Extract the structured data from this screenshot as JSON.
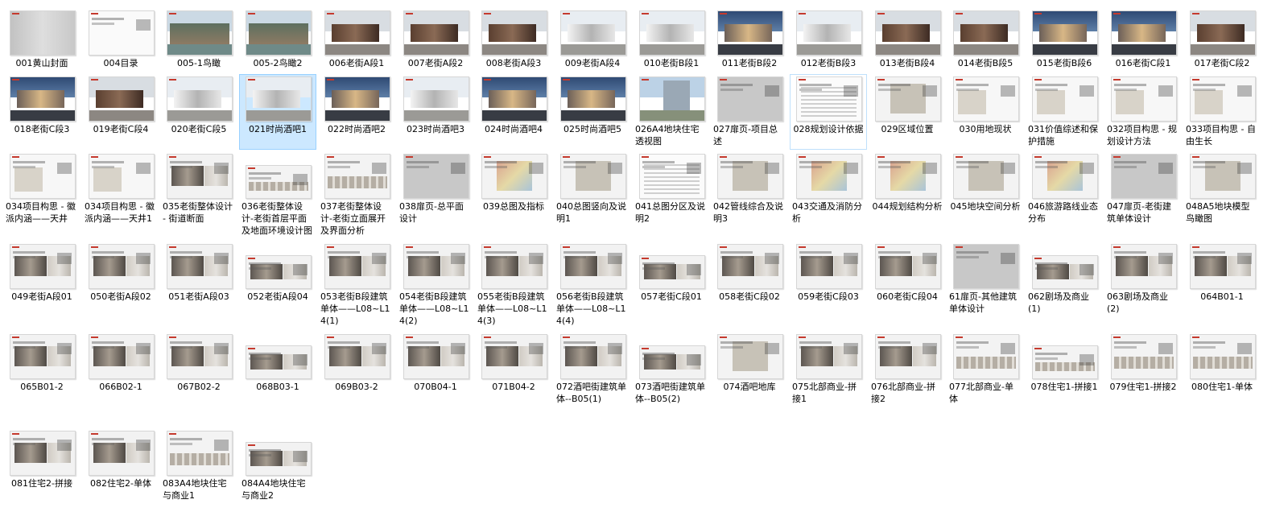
{
  "files": [
    {
      "name": "001黄山封面",
      "thumb": "cover"
    },
    {
      "name": "004目录",
      "thumb": "white"
    },
    {
      "name": "005-1鸟瞰",
      "thumb": "aerial"
    },
    {
      "name": "005-2鸟瞰2",
      "thumb": "aerial"
    },
    {
      "name": "006老街A段1",
      "thumb": "street"
    },
    {
      "name": "007老街A段2",
      "thumb": "street"
    },
    {
      "name": "008老街A段3",
      "thumb": "street"
    },
    {
      "name": "009老街A段4",
      "thumb": "modern"
    },
    {
      "name": "010老街B段1",
      "thumb": "modern"
    },
    {
      "name": "011老街B段2",
      "thumb": "dusk"
    },
    {
      "name": "012老街B段3",
      "thumb": "modern"
    },
    {
      "name": "013老街B段4",
      "thumb": "street"
    },
    {
      "name": "014老街B段5",
      "thumb": "street"
    },
    {
      "name": "015老街B段6",
      "thumb": "dusk"
    },
    {
      "name": "016老街C段1",
      "thumb": "dusk"
    },
    {
      "name": "017老街C段2",
      "thumb": "street"
    },
    {
      "name": "018老街C段3",
      "thumb": "dusk"
    },
    {
      "name": "019老街C段4",
      "thumb": "street"
    },
    {
      "name": "020老街C段5",
      "thumb": "modern"
    },
    {
      "name": "021时尚酒吧1",
      "thumb": "modern"
    },
    {
      "name": "022时尚酒吧2",
      "thumb": "dusk"
    },
    {
      "name": "023时尚酒吧3",
      "thumb": "modern"
    },
    {
      "name": "024时尚酒吧4",
      "thumb": "dusk"
    },
    {
      "name": "025时尚酒吧5",
      "thumb": "dusk"
    },
    {
      "name": "026A4地块住宅透视图",
      "thumb": "tower"
    },
    {
      "name": "027扉页-项目总述",
      "thumb": "grey"
    },
    {
      "name": "028规划设计依据",
      "thumb": "textdoc"
    },
    {
      "name": "029区域位置",
      "thumb": "plan"
    },
    {
      "name": "030用地现状",
      "thumb": "doc"
    },
    {
      "name": "031价值综述和保护措施",
      "thumb": "doc"
    },
    {
      "name": "032项目构思 - 规划设计方法",
      "thumb": "doc"
    },
    {
      "name": "033项目构思 - 自由生长",
      "thumb": "doc"
    },
    {
      "name": "034项目构思 - 徽派内涵——天井",
      "thumb": "doc"
    },
    {
      "name": "034项目构思 - 徽派内涵——天井1",
      "thumb": "doc"
    },
    {
      "name": "035老街整体设计 - 街道断面",
      "thumb": "board"
    },
    {
      "name": "036老街整体设计-老街首层平面及地面环境设计图",
      "thumb": "elev"
    },
    {
      "name": "037老街整体设计-老街立面展开及界面分析",
      "thumb": "elev"
    },
    {
      "name": "038扉页-总平面设计",
      "thumb": "grey"
    },
    {
      "name": "039总图及指标",
      "thumb": "plan color"
    },
    {
      "name": "040总图竖向及说明1",
      "thumb": "plan"
    },
    {
      "name": "041总图分区及说明2",
      "thumb": "textdoc"
    },
    {
      "name": "042管线综合及说明3",
      "thumb": "plan"
    },
    {
      "name": "043交通及消防分析",
      "thumb": "plan color"
    },
    {
      "name": "044规划结构分析",
      "thumb": "plan color"
    },
    {
      "name": "045地块空间分析",
      "thumb": "plan"
    },
    {
      "name": "046旅游路线业态分布",
      "thumb": "plan color"
    },
    {
      "name": "047扉页-老街建筑单体设计",
      "thumb": "grey"
    },
    {
      "name": "048A5地块模型鸟瞰图",
      "thumb": "plan"
    },
    {
      "name": "049老街A段01",
      "thumb": "board"
    },
    {
      "name": "050老街A段02",
      "thumb": "board"
    },
    {
      "name": "051老街A段03",
      "thumb": "board"
    },
    {
      "name": "052老街A段04",
      "thumb": "board"
    },
    {
      "name": "053老街B段建筑单体——L08~L14(1)",
      "thumb": "board"
    },
    {
      "name": "054老街B段建筑单体——L08~L14(2)",
      "thumb": "board"
    },
    {
      "name": "055老街B段建筑单体——L08~L14(3)",
      "thumb": "board"
    },
    {
      "name": "056老街B段建筑单体——L08~L14(4)",
      "thumb": "board"
    },
    {
      "name": "057老街C段01",
      "thumb": "board"
    },
    {
      "name": "058老街C段02",
      "thumb": "board"
    },
    {
      "name": "059老街C段03",
      "thumb": "board"
    },
    {
      "name": "060老街C段04",
      "thumb": "board"
    },
    {
      "name": "61扉页-其他建筑单体设计",
      "thumb": "grey"
    },
    {
      "name": "062剧场及商业(1)",
      "thumb": "board"
    },
    {
      "name": "063剧场及商业(2)",
      "thumb": "board"
    },
    {
      "name": "064B01-1",
      "thumb": "board"
    },
    {
      "name": "065B01-2",
      "thumb": "board"
    },
    {
      "name": "066B02-1",
      "thumb": "board"
    },
    {
      "name": "067B02-2",
      "thumb": "board"
    },
    {
      "name": "068B03-1",
      "thumb": "board"
    },
    {
      "name": "069B03-2",
      "thumb": "board"
    },
    {
      "name": "070B04-1",
      "thumb": "board"
    },
    {
      "name": "071B04-2",
      "thumb": "board"
    },
    {
      "name": "072酒吧街建筑单体--B05(1)",
      "thumb": "board"
    },
    {
      "name": "073酒吧街建筑单体--B05(2)",
      "thumb": "board"
    },
    {
      "name": "074酒吧地库",
      "thumb": "plan"
    },
    {
      "name": "075北部商业-拼接1",
      "thumb": "board"
    },
    {
      "name": "076北部商业-拼接2",
      "thumb": "board"
    },
    {
      "name": "077北部商业-单体",
      "thumb": "elev"
    },
    {
      "name": "078住宅1-拼接1",
      "thumb": "elev"
    },
    {
      "name": "079住宅1-拼接2",
      "thumb": "elev"
    },
    {
      "name": "080住宅1-单体",
      "thumb": "elev"
    },
    {
      "name": "081住宅2-拼接",
      "thumb": "board"
    },
    {
      "name": "082住宅2-单体",
      "thumb": "board"
    },
    {
      "name": "083A4地块住宅与商业1",
      "thumb": "elev"
    },
    {
      "name": "084A4地块住宅与商业2",
      "thumb": "board"
    }
  ],
  "selected_name": "021时尚酒吧1",
  "hover_name": "028规划设计依据",
  "colors": {
    "selection_bg": "#cce8ff",
    "selection_border": "#99d1ff",
    "hover_border": "#bfe0fb"
  }
}
